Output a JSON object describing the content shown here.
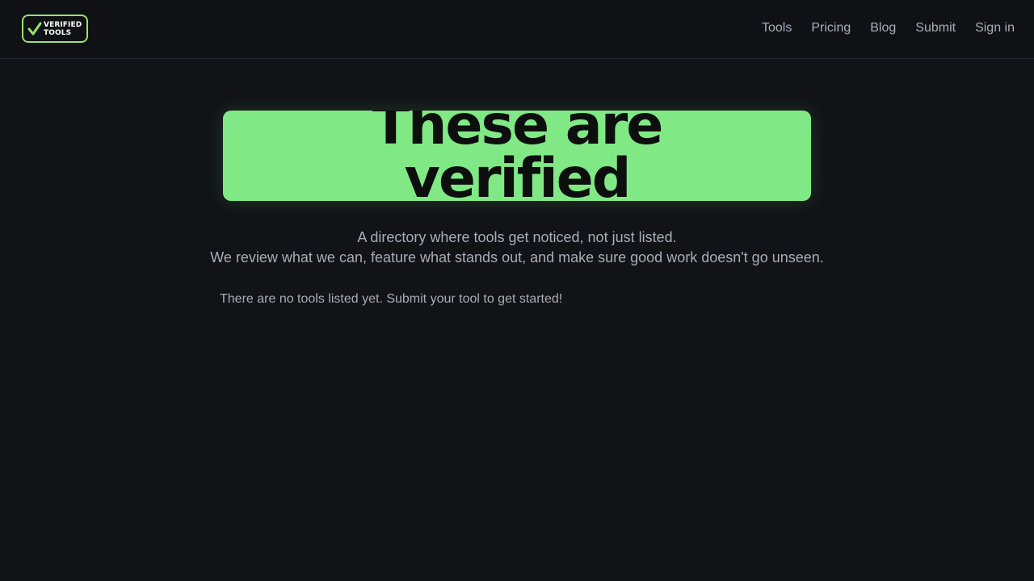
{
  "brand": {
    "logo_line1": "VERIFIED",
    "logo_line2": "TOOLS",
    "accent": "#9be26b"
  },
  "nav": {
    "items": [
      {
        "label": "Tools"
      },
      {
        "label": "Pricing"
      },
      {
        "label": "Blog"
      },
      {
        "label": "Submit"
      },
      {
        "label": "Sign in"
      }
    ]
  },
  "hero": {
    "title_line1": "These are",
    "title_line2": "verified",
    "bg_color": "#81e886"
  },
  "subtitle": {
    "line1": "A directory where tools get noticed, not just listed.",
    "line2": "We review what we can, feature what stands out, and make sure good work doesn't go unseen."
  },
  "listing": {
    "empty_message": "There are no tools listed yet. Submit your tool to get started!"
  }
}
